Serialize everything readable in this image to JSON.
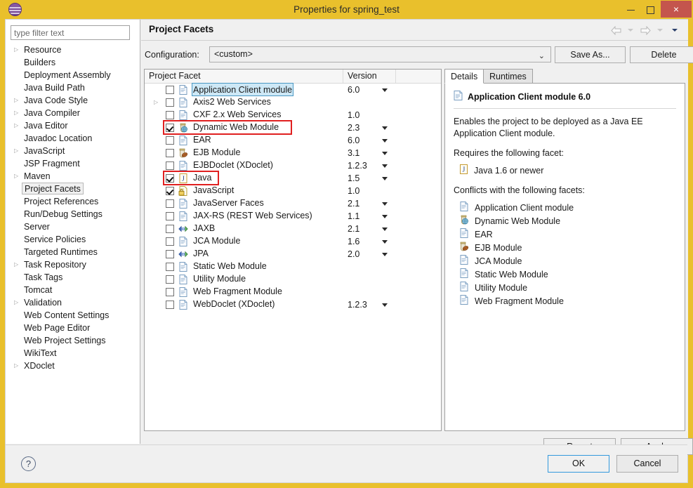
{
  "window": {
    "title": "Properties for spring_test",
    "app_icon": "eclipse-icon",
    "minimize_label": "",
    "maximize_label": "",
    "close_label": "×",
    "colors": {
      "titlebar": "#e9c02c",
      "close": "#c4554d",
      "selection": "#cde8f6",
      "highlight": "#e02020"
    }
  },
  "sidebar": {
    "filter": {
      "placeholder": "type filter text",
      "value": ""
    },
    "items": [
      {
        "label": "Resource",
        "expandable": true,
        "selected": false
      },
      {
        "label": "Builders",
        "expandable": false,
        "selected": false
      },
      {
        "label": "Deployment Assembly",
        "expandable": false,
        "selected": false
      },
      {
        "label": "Java Build Path",
        "expandable": false,
        "selected": false
      },
      {
        "label": "Java Code Style",
        "expandable": true,
        "selected": false
      },
      {
        "label": "Java Compiler",
        "expandable": true,
        "selected": false
      },
      {
        "label": "Java Editor",
        "expandable": true,
        "selected": false
      },
      {
        "label": "Javadoc Location",
        "expandable": false,
        "selected": false
      },
      {
        "label": "JavaScript",
        "expandable": true,
        "selected": false
      },
      {
        "label": "JSP Fragment",
        "expandable": false,
        "selected": false
      },
      {
        "label": "Maven",
        "expandable": true,
        "selected": false
      },
      {
        "label": "Project Facets",
        "expandable": false,
        "selected": true
      },
      {
        "label": "Project References",
        "expandable": false,
        "selected": false
      },
      {
        "label": "Run/Debug Settings",
        "expandable": false,
        "selected": false
      },
      {
        "label": "Server",
        "expandable": false,
        "selected": false
      },
      {
        "label": "Service Policies",
        "expandable": false,
        "selected": false
      },
      {
        "label": "Targeted Runtimes",
        "expandable": false,
        "selected": false
      },
      {
        "label": "Task Repository",
        "expandable": true,
        "selected": false
      },
      {
        "label": "Task Tags",
        "expandable": false,
        "selected": false
      },
      {
        "label": "Tomcat",
        "expandable": false,
        "selected": false
      },
      {
        "label": "Validation",
        "expandable": true,
        "selected": false
      },
      {
        "label": "Web Content Settings",
        "expandable": false,
        "selected": false
      },
      {
        "label": "Web Page Editor",
        "expandable": false,
        "selected": false
      },
      {
        "label": "Web Project Settings",
        "expandable": false,
        "selected": false
      },
      {
        "label": "WikiText",
        "expandable": false,
        "selected": false
      },
      {
        "label": "XDoclet",
        "expandable": true,
        "selected": false
      }
    ]
  },
  "page": {
    "title": "Project Facets",
    "nav": {
      "back": "back-arrow",
      "back_menu": "back-dropdown",
      "forward": "forward-arrow",
      "forward_menu": "forward-dropdown",
      "menu": "view-menu"
    }
  },
  "configuration": {
    "label": "Configuration:",
    "value": "<custom>",
    "save_as_label": "Save As...",
    "delete_label": "Delete"
  },
  "facets_table": {
    "columns": [
      "Project Facet",
      "Version",
      ""
    ],
    "rows": [
      {
        "name": "Application Client module",
        "version": "6.0",
        "checked": false,
        "selected": true,
        "expandable": false,
        "has_version_dropdown": true,
        "icon": "document-icon"
      },
      {
        "name": "Axis2 Web Services",
        "version": "",
        "checked": false,
        "selected": false,
        "expandable": true,
        "has_version_dropdown": false,
        "icon": "document-icon"
      },
      {
        "name": "CXF 2.x Web Services",
        "version": "1.0",
        "checked": false,
        "selected": false,
        "expandable": false,
        "has_version_dropdown": false,
        "icon": "document-icon"
      },
      {
        "name": "Dynamic Web Module",
        "version": "2.3",
        "checked": true,
        "selected": false,
        "expandable": false,
        "has_version_dropdown": true,
        "icon": "web-module-icon",
        "highlighted": true
      },
      {
        "name": "EAR",
        "version": "6.0",
        "checked": false,
        "selected": false,
        "expandable": false,
        "has_version_dropdown": true,
        "icon": "document-icon"
      },
      {
        "name": "EJB Module",
        "version": "3.1",
        "checked": false,
        "selected": false,
        "expandable": false,
        "has_version_dropdown": true,
        "icon": "ejb-module-icon"
      },
      {
        "name": "EJBDoclet (XDoclet)",
        "version": "1.2.3",
        "checked": false,
        "selected": false,
        "expandable": false,
        "has_version_dropdown": true,
        "icon": "document-icon"
      },
      {
        "name": "Java",
        "version": "1.5",
        "checked": true,
        "selected": false,
        "expandable": false,
        "has_version_dropdown": true,
        "icon": "java-icon",
        "highlighted": true
      },
      {
        "name": "JavaScript",
        "version": "1.0",
        "checked": true,
        "selected": false,
        "expandable": false,
        "has_version_dropdown": false,
        "icon": "javascript-icon"
      },
      {
        "name": "JavaServer Faces",
        "version": "2.1",
        "checked": false,
        "selected": false,
        "expandable": false,
        "has_version_dropdown": true,
        "icon": "document-icon"
      },
      {
        "name": "JAX-RS (REST Web Services)",
        "version": "1.1",
        "checked": false,
        "selected": false,
        "expandable": false,
        "has_version_dropdown": true,
        "icon": "document-icon"
      },
      {
        "name": "JAXB",
        "version": "2.1",
        "checked": false,
        "selected": false,
        "expandable": false,
        "has_version_dropdown": true,
        "icon": "xml-binding-icon"
      },
      {
        "name": "JCA Module",
        "version": "1.6",
        "checked": false,
        "selected": false,
        "expandable": false,
        "has_version_dropdown": true,
        "icon": "document-icon"
      },
      {
        "name": "JPA",
        "version": "2.0",
        "checked": false,
        "selected": false,
        "expandable": false,
        "has_version_dropdown": true,
        "icon": "xml-binding-icon"
      },
      {
        "name": "Static Web Module",
        "version": "",
        "checked": false,
        "selected": false,
        "expandable": false,
        "has_version_dropdown": false,
        "icon": "document-icon"
      },
      {
        "name": "Utility Module",
        "version": "",
        "checked": false,
        "selected": false,
        "expandable": false,
        "has_version_dropdown": false,
        "icon": "document-icon"
      },
      {
        "name": "Web Fragment Module",
        "version": "",
        "checked": false,
        "selected": false,
        "expandable": false,
        "has_version_dropdown": false,
        "icon": "document-icon"
      },
      {
        "name": "WebDoclet (XDoclet)",
        "version": "1.2.3",
        "checked": false,
        "selected": false,
        "expandable": false,
        "has_version_dropdown": true,
        "icon": "document-icon"
      }
    ]
  },
  "details": {
    "tabs": [
      {
        "label": "Details",
        "active": true
      },
      {
        "label": "Runtimes",
        "active": false
      }
    ],
    "title": "Application Client module 6.0",
    "title_icon": "document-icon",
    "description": "Enables the project to be deployed as a Java EE Application Client module.",
    "requires_heading": "Requires the following facet:",
    "requires": [
      {
        "label": "Java 1.6 or newer",
        "icon": "java-icon"
      }
    ],
    "conflicts_heading": "Conflicts with the following facets:",
    "conflicts": [
      {
        "label": "Application Client module",
        "icon": "document-icon"
      },
      {
        "label": "Dynamic Web Module",
        "icon": "web-module-icon"
      },
      {
        "label": "EAR",
        "icon": "document-icon"
      },
      {
        "label": "EJB Module",
        "icon": "ejb-module-icon"
      },
      {
        "label": "JCA Module",
        "icon": "document-icon"
      },
      {
        "label": "Static Web Module",
        "icon": "document-icon"
      },
      {
        "label": "Utility Module",
        "icon": "document-icon"
      },
      {
        "label": "Web Fragment Module",
        "icon": "document-icon"
      }
    ]
  },
  "page_buttons": {
    "revert": "Revert",
    "apply": "Apply"
  },
  "dialog_buttons": {
    "help": "?",
    "ok": "OK",
    "cancel": "Cancel"
  }
}
